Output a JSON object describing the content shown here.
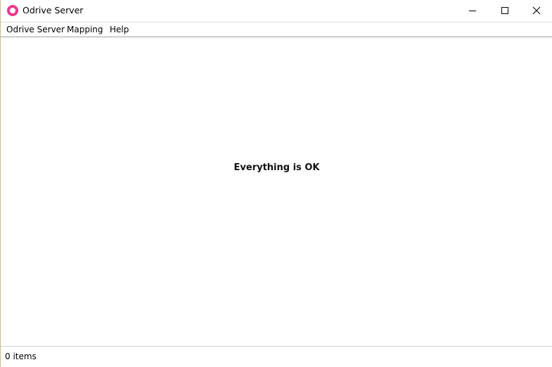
{
  "window": {
    "title": "Odrive Server",
    "icon": "app-ring-icon",
    "accent_color": "#ec3a8c",
    "controls": {
      "minimize": "minimize-icon",
      "maximize": "maximize-icon",
      "close": "close-icon"
    }
  },
  "menu": {
    "items": [
      {
        "label": "Odrive Server"
      },
      {
        "label": "Mapping"
      },
      {
        "label": "Help"
      }
    ]
  },
  "main": {
    "message": "Everything is OK"
  },
  "statusbar": {
    "items_count": "0 items"
  }
}
